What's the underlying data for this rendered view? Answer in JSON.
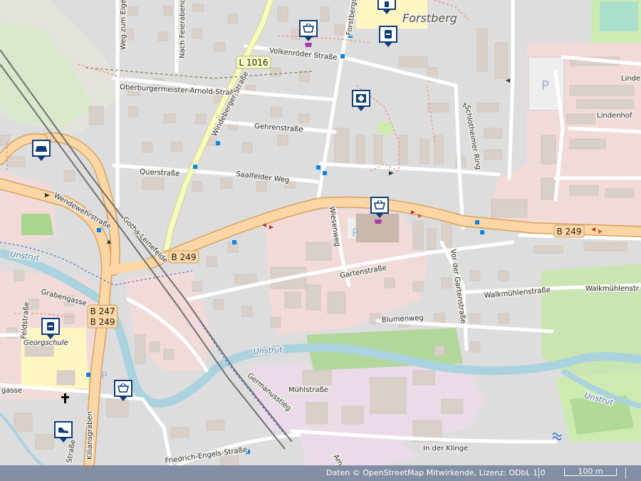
{
  "map": {
    "colors": {
      "background": "#dddddd",
      "residential": "#e0dfdf",
      "built": "#d9d0c9",
      "retail": "#f2dad9",
      "industrial": "#ebdbe8",
      "school": "#fff6c2",
      "grass": "#cdebb0",
      "meadow": "#c8e5b2",
      "forest": "#a9d68f",
      "water": "#aad3df",
      "major_road": "#fcd6a4",
      "major_road_casing": "#d9a15c",
      "secondary_road": "#f7fabf",
      "rail": "#707070",
      "poi_blue": "#0f3d7a",
      "bus_stop": "#0a84e6",
      "parking": "#eeeeee"
    },
    "place_labels": {
      "forstberg": "Forstberg",
      "georgschule": "Georgschule"
    },
    "water_labels": {
      "unstrut_1": "Unstrut",
      "unstrut_2": "Unstrut",
      "unstrut_3": "Unstrut"
    },
    "road_labels": {
      "weg_zum_eigen": "Weg zum Eigen",
      "nach_feierabend": "Nach Feierabend",
      "forstbergstrasse": "Forstbergstraße",
      "volkenroder": "Volkenröder Straße",
      "oberbuergermeister": "Oberburgermeister-Arnold-Straße",
      "windeberger": "Windeberger Straße",
      "gehrenstrasse": "Gehrenstraße",
      "querstrasse": "Querstraße",
      "saalfelder": "Saalfelder Weg",
      "wendewehrstrasse": "Wendewehrstraße",
      "gotha_leinefelde": "Gotha-Leinefelde",
      "wiesenweg": "Wiesenweg",
      "gartenstrasse": "Gartenstraße",
      "vor_der_gartenstrasse": "Vor der Gartenstraße",
      "walkmuehlenstrasse": "Walkmühlenstraße",
      "walkmuehlenstr_2": "Walkmühlenstr",
      "blumenweg": "Blumenweg",
      "schlotheimer_ring": "Schlotheimer Ring",
      "lindenhof": "Lindenhof",
      "linde": "Linde",
      "grabengasse": "Grabengasse",
      "feldstrasse": "Feldstraße",
      "kiliansgraben": "Kiliansgraben",
      "germanusstieg": "Germanusstieg",
      "muehlstrasse": "Mühlstraße",
      "in_der_klinge": "In der Klinge",
      "friedrich_engels": "Friedrich-Engels-Straße",
      "gasse": "gasse",
      "am": "Am",
      "strasse_partial": "Straße"
    },
    "shields": {
      "l1016": "L 1016",
      "b249_center": "B 249",
      "b249_right": "B 249",
      "b247": "B 247",
      "b249_left": "B 249"
    },
    "poi_icons": {
      "supermarket_top": "basket-icon",
      "school_top": "school-icon",
      "school_top2": "backpack-icon",
      "pharmacy": "pharmacy-icon",
      "furniture": "sofa-icon",
      "supermarket_center": "basket-icon",
      "school_left": "backpack-icon",
      "supermarket_bottom": "basket-icon",
      "shoes": "shoe-icon"
    },
    "parking_symbol": "P"
  },
  "attribution": {
    "text": "Daten © OpenStreetMap Mitwirkende, Lizenz: ODbL 1.0",
    "scale_label": "100 m"
  }
}
